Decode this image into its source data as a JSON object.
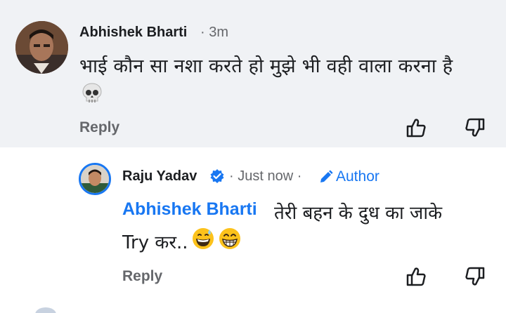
{
  "comment": {
    "author_name": "Abhishek Bharti",
    "time": "· 3m",
    "text": "भाई कौन सा नशा करते हो मुझे भी वही वाला करना है",
    "emoji": "skull-emoji",
    "reply_label": "Reply"
  },
  "reply": {
    "author_name": "Raju Yadav",
    "time": "· Just now ·",
    "author_badge": "Author",
    "mention": "Abhishek Bharti",
    "text_line1": "तेरी बहन के दुध का जाके",
    "text_line2": "Try कर..",
    "emojis": [
      "grinning-sweat-emoji",
      "grin-emoji"
    ],
    "reply_label": "Reply"
  },
  "colors": {
    "accent": "#1877f2",
    "muted": "#65676b",
    "comment_bg": "#f0f2f5"
  }
}
